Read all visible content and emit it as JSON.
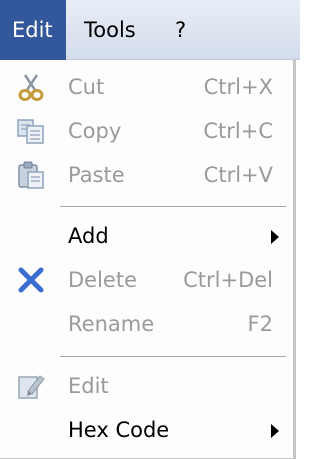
{
  "menubar": {
    "items": [
      {
        "label": "Edit"
      },
      {
        "label": "Tools"
      },
      {
        "label": "?"
      }
    ]
  },
  "menu": {
    "items": [
      {
        "label": "Cut",
        "shortcut": "Ctrl+X",
        "icon": "scissors-icon",
        "enabled": false
      },
      {
        "label": "Copy",
        "shortcut": "Ctrl+C",
        "icon": "copy-icon",
        "enabled": false
      },
      {
        "label": "Paste",
        "shortcut": "Ctrl+V",
        "icon": "paste-icon",
        "enabled": false
      },
      {
        "label": "Add",
        "submenu": true,
        "enabled": true
      },
      {
        "label": "Delete",
        "shortcut": "Ctrl+Del",
        "icon": "delete-x-icon",
        "enabled": false
      },
      {
        "label": "Rename",
        "shortcut": "F2",
        "enabled": false
      },
      {
        "label": "Edit",
        "icon": "edit-icon",
        "enabled": false
      },
      {
        "label": "Hex Code",
        "submenu": true,
        "enabled": true
      }
    ]
  },
  "colors": {
    "menubar_active": "#33579b",
    "disabled_text": "#9a9a9a",
    "delete_icon": "#3a6fd1"
  }
}
